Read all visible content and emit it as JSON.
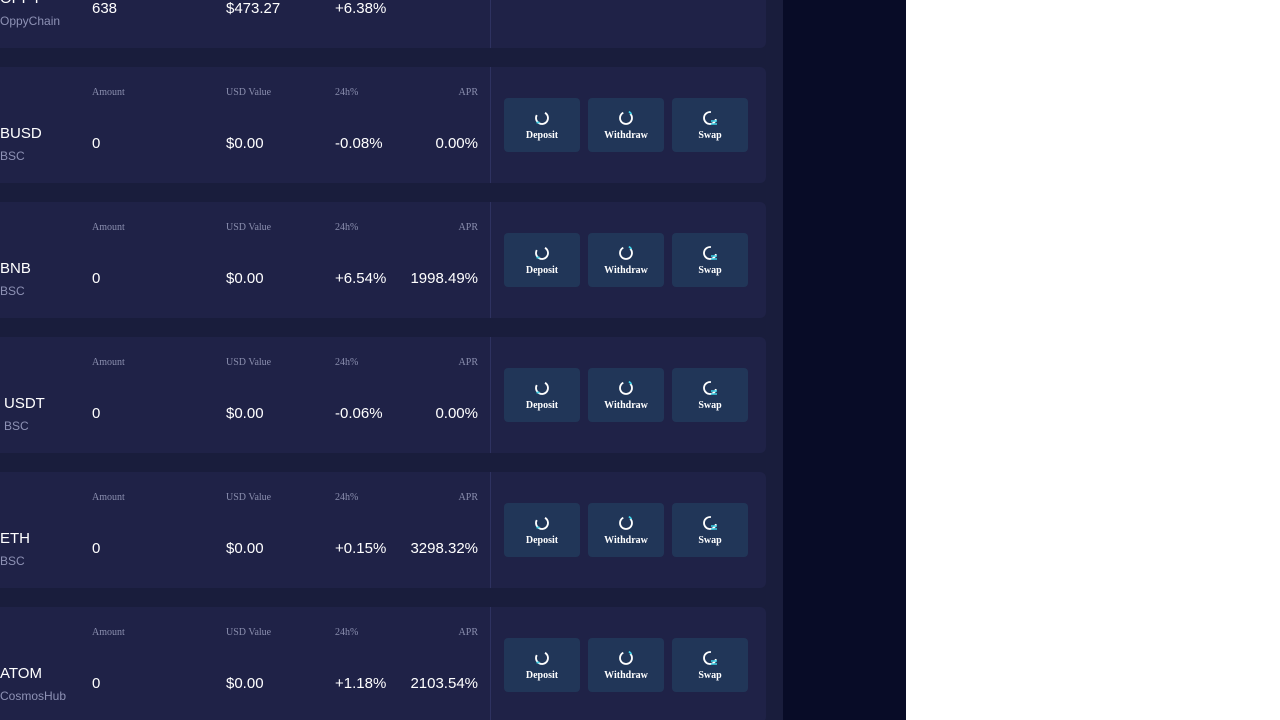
{
  "colors": {
    "app_background": "#080c27",
    "panel_background": "#191d3c",
    "card_background": "#1f2247",
    "button_background": "#213658",
    "icon_accent": "#3fd3e8",
    "muted_text": "#8a8eae"
  },
  "columns": {
    "amount": "Amount",
    "usd_value": "USD Value",
    "change": "24h%",
    "apr": "APR"
  },
  "actions": {
    "deposit": "Deposit",
    "withdraw": "Withdraw",
    "swap": "Swap"
  },
  "icons": {
    "deposit": "deposit-refresh-icon",
    "withdraw": "withdraw-refresh-icon",
    "swap": "swap-refresh-icon"
  },
  "assets": [
    {
      "symbol": "OPPY",
      "chain": "OppyChain",
      "amount": "638",
      "usd_value": "$473.27",
      "change": "+6.38%",
      "apr": ""
    },
    {
      "symbol": "BUSD",
      "chain": "BSC",
      "amount": "0",
      "usd_value": "$0.00",
      "change": "-0.08%",
      "apr": "0.00%"
    },
    {
      "symbol": "BNB",
      "chain": "BSC",
      "amount": "0",
      "usd_value": "$0.00",
      "change": "+6.54%",
      "apr": "1998.49%"
    },
    {
      "symbol": "USDT",
      "chain": "BSC",
      "amount": "0",
      "usd_value": "$0.00",
      "change": "-0.06%",
      "apr": "0.00%"
    },
    {
      "symbol": "ETH",
      "chain": "BSC",
      "amount": "0",
      "usd_value": "$0.00",
      "change": "+0.15%",
      "apr": "3298.32%"
    },
    {
      "symbol": "ATOM",
      "chain": "CosmosHub",
      "amount": "0",
      "usd_value": "$0.00",
      "change": "+1.18%",
      "apr": "2103.54%"
    }
  ]
}
